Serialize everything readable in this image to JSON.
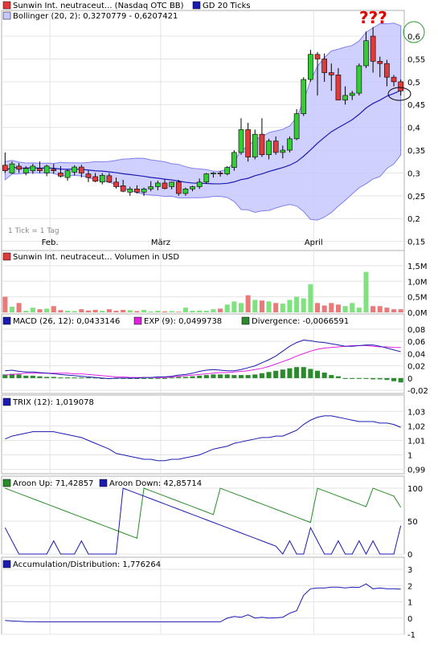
{
  "colors": {
    "up": "#33cc33",
    "down": "#e03b3b",
    "line": "#1b1bb0",
    "band_fill": "#c8c8ff",
    "band_stroke": "#8080ee",
    "magenta": "#e020e0",
    "green": "#2b8a2b",
    "grid": "#e4e4e4",
    "vol_up": "#7ee27e",
    "vol_down": "#e87a7a",
    "annotation": "#e00000",
    "circle_green": "#2a9a2a"
  },
  "price_panel": {
    "legend": [
      {
        "swatch": "#e03b3b",
        "label": "Sunwin Int. neutraceut... (Nasdaq OTC BB)"
      },
      {
        "swatch": "#1b1bb0",
        "label": "GD 20 Ticks"
      },
      {
        "swatch": "#c8c8ff",
        "label": "Bollinger (20, 2): 0,3270779 - 0,6207421"
      }
    ],
    "note": "1 Tick = 1 Tag",
    "annotation": "???",
    "x_labels": [
      "Feb.",
      "März",
      "April"
    ],
    "y_ticks": [
      "0,6",
      "0,55",
      "0,5",
      "0,45",
      "0,4",
      "0,35",
      "0,3",
      "0,25",
      "0,2",
      "0,15"
    ]
  },
  "volume_panel": {
    "legend": [
      {
        "swatch": "#e03b3b",
        "label": "Sunwin Int. neutraceut... Volumen in USD"
      }
    ],
    "y_ticks": [
      "1,5M",
      "1,0M",
      "0,5M",
      "0,0M"
    ]
  },
  "macd_panel": {
    "legend": [
      {
        "swatch": "#1b1bb0",
        "label": "MACD (26, 12): 0,0433146"
      },
      {
        "swatch": "#e020e0",
        "label": "EXP (9): 0,0499738"
      },
      {
        "swatch": "#2b8a2b",
        "label": "Divergence: -0,0066591"
      }
    ],
    "y_ticks": [
      "0,08",
      "0,06",
      "0,04",
      "0,02",
      "0",
      "-0,02"
    ]
  },
  "trix_panel": {
    "legend": [
      {
        "swatch": "#1b1bb0",
        "label": "TRIX (12): 1,019078"
      }
    ],
    "y_ticks": [
      "1,03",
      "1,02",
      "1,01",
      "1",
      "0,99"
    ]
  },
  "aroon_panel": {
    "legend": [
      {
        "swatch": "#2b8a2b",
        "label": "Aroon Up: 71,42857"
      },
      {
        "swatch": "#1b1bb0",
        "label": "Aroon Down: 42,85714"
      }
    ],
    "y_ticks": [
      "100",
      "50",
      "0"
    ]
  },
  "ad_panel": {
    "legend": [
      {
        "swatch": "#1b1bb0",
        "label": "Accumulation/Distribution: 1,776264"
      }
    ],
    "y_ticks": [
      "3",
      "2",
      "1",
      "0",
      "-1"
    ]
  },
  "chart_data": [
    {
      "type": "candlestick",
      "series": [
        {
          "name": "Sunwin Int. neutraceut... (Nasdaq OTC BB)",
          "ohlc": [
            [
              0.317,
              0.345,
              0.3,
              0.305
            ],
            [
              0.3,
              0.325,
              0.298,
              0.32
            ],
            [
              0.315,
              0.322,
              0.3,
              0.308
            ],
            [
              0.3,
              0.315,
              0.295,
              0.31
            ],
            [
              0.305,
              0.32,
              0.298,
              0.315
            ],
            [
              0.31,
              0.325,
              0.3,
              0.305
            ],
            [
              0.3,
              0.318,
              0.293,
              0.315
            ],
            [
              0.308,
              0.32,
              0.298,
              0.305
            ],
            [
              0.3,
              0.315,
              0.29,
              0.293
            ],
            [
              0.29,
              0.308,
              0.283,
              0.305
            ],
            [
              0.302,
              0.317,
              0.295,
              0.313
            ],
            [
              0.313,
              0.318,
              0.29,
              0.3
            ],
            [
              0.298,
              0.305,
              0.28,
              0.29
            ],
            [
              0.292,
              0.3,
              0.28,
              0.282
            ],
            [
              0.28,
              0.3,
              0.275,
              0.295
            ],
            [
              0.294,
              0.3,
              0.278,
              0.28
            ],
            [
              0.28,
              0.29,
              0.266,
              0.27
            ],
            [
              0.272,
              0.285,
              0.258,
              0.26
            ],
            [
              0.258,
              0.27,
              0.25,
              0.265
            ],
            [
              0.265,
              0.273,
              0.255,
              0.258
            ],
            [
              0.258,
              0.268,
              0.25,
              0.265
            ],
            [
              0.265,
              0.282,
              0.26,
              0.27
            ],
            [
              0.27,
              0.283,
              0.262,
              0.278
            ],
            [
              0.278,
              0.286,
              0.264,
              0.266
            ],
            [
              0.27,
              0.281,
              0.264,
              0.28
            ],
            [
              0.28,
              0.285,
              0.25,
              0.255
            ],
            [
              0.255,
              0.268,
              0.25,
              0.265
            ],
            [
              0.265,
              0.272,
              0.26,
              0.27
            ],
            [
              0.27,
              0.288,
              0.265,
              0.28
            ],
            [
              0.28,
              0.3,
              0.276,
              0.298
            ],
            [
              0.298,
              0.302,
              0.29,
              0.3
            ],
            [
              0.3,
              0.305,
              0.292,
              0.298
            ],
            [
              0.298,
              0.315,
              0.295,
              0.312
            ],
            [
              0.312,
              0.35,
              0.305,
              0.345
            ],
            [
              0.345,
              0.42,
              0.34,
              0.395
            ],
            [
              0.395,
              0.41,
              0.325,
              0.335
            ],
            [
              0.335,
              0.395,
              0.33,
              0.385
            ],
            [
              0.385,
              0.42,
              0.335,
              0.34
            ],
            [
              0.34,
              0.375,
              0.33,
              0.37
            ],
            [
              0.37,
              0.38,
              0.34,
              0.345
            ],
            [
              0.345,
              0.36,
              0.332,
              0.35
            ],
            [
              0.35,
              0.38,
              0.345,
              0.375
            ],
            [
              0.375,
              0.44,
              0.372,
              0.43
            ],
            [
              0.43,
              0.51,
              0.425,
              0.505
            ],
            [
              0.505,
              0.57,
              0.5,
              0.56
            ],
            [
              0.56,
              0.565,
              0.47,
              0.55
            ],
            [
              0.55,
              0.562,
              0.5,
              0.52
            ],
            [
              0.52,
              0.54,
              0.48,
              0.515
            ],
            [
              0.515,
              0.53,
              0.46,
              0.46
            ],
            [
              0.46,
              0.49,
              0.45,
              0.47
            ],
            [
              0.47,
              0.48,
              0.46,
              0.475
            ],
            [
              0.475,
              0.54,
              0.47,
              0.535
            ],
            [
              0.535,
              0.61,
              0.53,
              0.59
            ],
            [
              0.6,
              0.62,
              0.52,
              0.545
            ],
            [
              0.545,
              0.555,
              0.51,
              0.54
            ],
            [
              0.54,
              0.548,
              0.49,
              0.51
            ],
            [
              0.51,
              0.515,
              0.49,
              0.5
            ],
            [
              0.5,
              0.505,
              0.47,
              0.48
            ]
          ]
        }
      ],
      "ylim": [
        0.13,
        0.63
      ]
    },
    {
      "type": "bar",
      "series": [
        {
          "name": "Volumen",
          "values": [
            0.5,
            0.18,
            0.3,
            0.05,
            0.15,
            0.1,
            0.12,
            0.2,
            0.07,
            0.05,
            0.04,
            0.1,
            0.06,
            0.08,
            0.05,
            0.1,
            0.05,
            0.08,
            0.07,
            0.04,
            0.08,
            0.03,
            0.05,
            0.03,
            0.04,
            0.02,
            0.15,
            0.05,
            0.06,
            0.05,
            0.1,
            0.12,
            0.25,
            0.35,
            0.3,
            0.55,
            0.4,
            0.38,
            0.35,
            0.3,
            0.28,
            0.4,
            0.5,
            0.45,
            0.9,
            0.3,
            0.22,
            0.3,
            0.25,
            0.2,
            0.3,
            0.15,
            1.3,
            0.2,
            0.2,
            0.15,
            0.1,
            0.1
          ]
        }
      ],
      "ylim": [
        0,
        1.6
      ]
    },
    {
      "type": "line",
      "series": [
        {
          "name": "MACD (26, 12)",
          "values": [
            0.012,
            0.013,
            0.011,
            0.01,
            0.01,
            0.009,
            0.008,
            0.007,
            0.006,
            0.005,
            0.004,
            0.003,
            0.002,
            0.001,
            0.0,
            -0.001,
            0.0,
            0.0,
            0.0,
            0.0,
            0.001,
            0.001,
            0.002,
            0.002,
            0.003,
            0.005,
            0.006,
            0.008,
            0.011,
            0.013,
            0.014,
            0.013,
            0.012,
            0.012,
            0.014,
            0.017,
            0.02,
            0.025,
            0.03,
            0.036,
            0.044,
            0.052,
            0.058,
            0.062,
            0.061,
            0.059,
            0.058,
            0.056,
            0.054,
            0.052,
            0.052,
            0.053,
            0.054,
            0.054,
            0.052,
            0.049,
            0.046,
            0.043
          ]
        },
        {
          "name": "EXP (9)",
          "values": [
            0.005,
            0.006,
            0.007,
            0.008,
            0.008,
            0.008,
            0.008,
            0.008,
            0.008,
            0.008,
            0.007,
            0.007,
            0.006,
            0.005,
            0.004,
            0.003,
            0.002,
            0.002,
            0.001,
            0.001,
            0.001,
            0.001,
            0.001,
            0.001,
            0.002,
            0.003,
            0.004,
            0.005,
            0.006,
            0.007,
            0.008,
            0.009,
            0.009,
            0.01,
            0.011,
            0.012,
            0.014,
            0.016,
            0.019,
            0.023,
            0.027,
            0.031,
            0.036,
            0.04,
            0.044,
            0.047,
            0.049,
            0.05,
            0.051,
            0.052,
            0.053,
            0.053,
            0.053,
            0.052,
            0.051,
            0.051,
            0.05,
            0.05
          ]
        },
        {
          "name": "Divergence",
          "values": [
            0.006,
            0.007,
            0.006,
            0.004,
            0.004,
            0.003,
            0.002,
            0.002,
            0.001,
            0.001,
            0.001,
            0.001,
            0.001,
            0.001,
            0.0,
            0.0,
            0.0,
            0.0,
            0.0,
            0.0,
            0.0,
            0.0,
            0.0,
            0.0,
            0.001,
            0.002,
            0.002,
            0.003,
            0.004,
            0.005,
            0.006,
            0.006,
            0.006,
            0.005,
            0.005,
            0.005,
            0.006,
            0.008,
            0.01,
            0.012,
            0.014,
            0.016,
            0.018,
            0.018,
            0.015,
            0.012,
            0.009,
            0.005,
            0.003,
            0.0,
            -0.001,
            -0.001,
            -0.001,
            -0.002,
            -0.002,
            -0.003,
            -0.005,
            -0.007
          ]
        }
      ],
      "ylim": [
        -0.025,
        0.085
      ]
    },
    {
      "type": "line",
      "series": [
        {
          "name": "TRIX (12)",
          "values": [
            1.011,
            1.013,
            1.014,
            1.015,
            1.016,
            1.016,
            1.016,
            1.016,
            1.015,
            1.014,
            1.013,
            1.012,
            1.01,
            1.008,
            1.006,
            1.004,
            1.001,
            1.0,
            0.999,
            0.998,
            0.997,
            0.997,
            0.996,
            0.996,
            0.997,
            0.997,
            0.998,
            0.999,
            1.0,
            1.002,
            1.004,
            1.005,
            1.006,
            1.008,
            1.009,
            1.01,
            1.011,
            1.012,
            1.012,
            1.013,
            1.013,
            1.015,
            1.017,
            1.021,
            1.024,
            1.026,
            1.027,
            1.027,
            1.026,
            1.025,
            1.024,
            1.023,
            1.023,
            1.023,
            1.022,
            1.022,
            1.021,
            1.019
          ]
        }
      ],
      "ylim": [
        0.987,
        1.033
      ]
    },
    {
      "type": "line",
      "series": [
        {
          "name": "Aroon Up",
          "values": [
            100,
            96,
            92,
            88,
            84,
            80,
            76,
            72,
            68,
            64,
            60,
            56,
            52,
            48,
            44,
            40,
            36,
            32,
            28,
            24,
            100,
            96,
            92,
            88,
            84,
            80,
            76,
            72,
            68,
            64,
            60,
            100,
            96,
            92,
            88,
            84,
            80,
            76,
            72,
            68,
            64,
            60,
            56,
            52,
            48,
            100,
            96,
            92,
            88,
            84,
            80,
            76,
            72,
            100,
            96,
            92,
            88,
            71
          ]
        },
        {
          "name": "Aroon Down",
          "values": [
            40,
            20,
            0,
            0,
            0,
            0,
            0,
            20,
            0,
            0,
            0,
            20,
            0,
            0,
            0,
            0,
            0,
            100,
            96,
            92,
            88,
            84,
            80,
            76,
            72,
            68,
            64,
            60,
            56,
            52,
            48,
            44,
            40,
            36,
            32,
            28,
            24,
            20,
            16,
            12,
            0,
            20,
            0,
            0,
            40,
            20,
            0,
            0,
            20,
            0,
            0,
            20,
            0,
            20,
            0,
            0,
            0,
            43
          ]
        }
      ],
      "ylim": [
        0,
        100
      ]
    },
    {
      "type": "line",
      "series": [
        {
          "name": "Accumulation/Distribution",
          "values": [
            -0.15,
            -0.18,
            -0.2,
            -0.22,
            -0.22,
            -0.23,
            -0.23,
            -0.23,
            -0.23,
            -0.23,
            -0.23,
            -0.23,
            -0.23,
            -0.23,
            -0.23,
            -0.23,
            -0.23,
            -0.23,
            -0.23,
            -0.23,
            -0.23,
            -0.23,
            -0.23,
            -0.23,
            -0.23,
            -0.23,
            -0.23,
            -0.23,
            -0.23,
            -0.23,
            -0.23,
            -0.23,
            0.0,
            0.1,
            0.05,
            0.2,
            0.0,
            0.05,
            0.0,
            0.02,
            0.05,
            0.3,
            0.45,
            1.4,
            1.8,
            1.85,
            1.85,
            1.9,
            1.9,
            1.85,
            1.9,
            1.88,
            2.1,
            1.8,
            1.85,
            1.8,
            1.8,
            1.78
          ]
        }
      ],
      "ylim": [
        -1,
        3
      ]
    }
  ]
}
